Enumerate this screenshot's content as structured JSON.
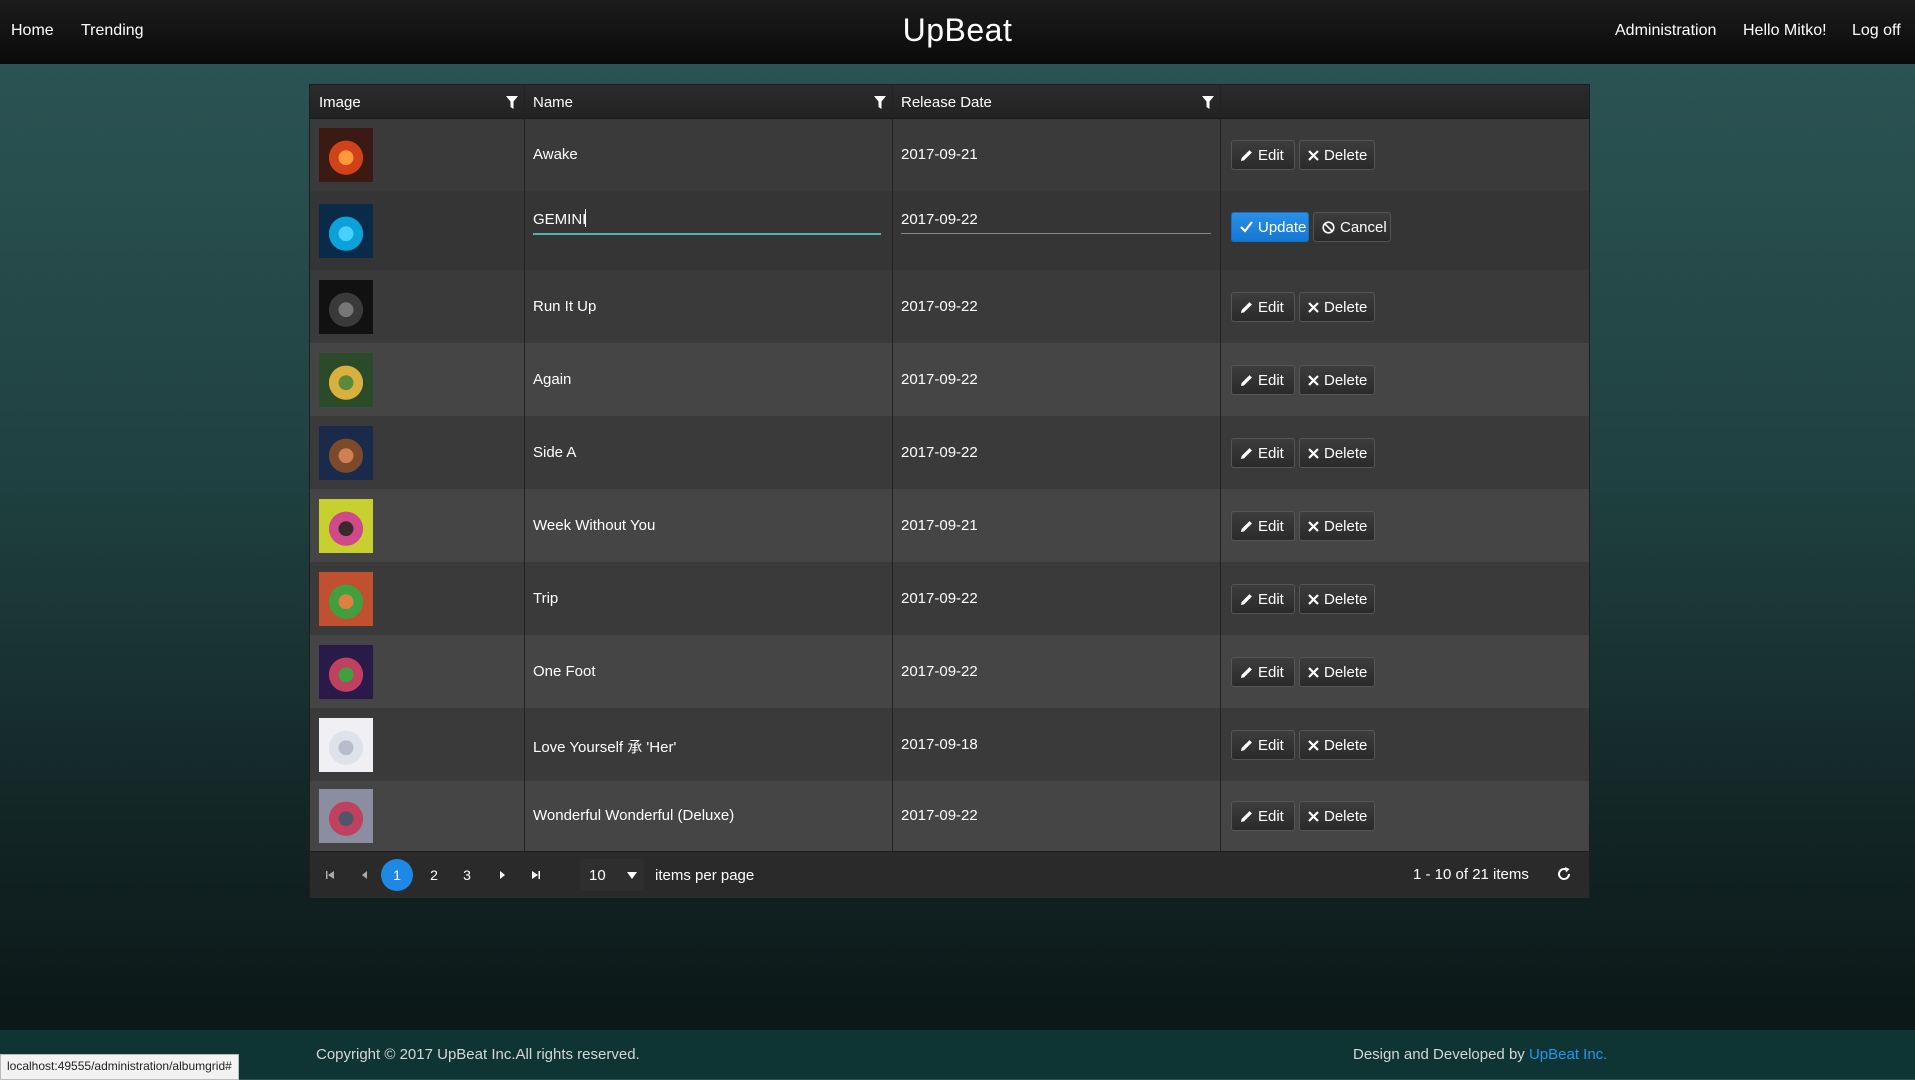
{
  "nav": {
    "home": "Home",
    "trending": "Trending",
    "brand": "UpBeat",
    "administration": "Administration",
    "greeting": "Hello Mitko!",
    "logoff": "Log off"
  },
  "grid": {
    "columns": {
      "image": "Image",
      "name": "Name",
      "release": "Release Date"
    },
    "rows": [
      {
        "name": "Awake",
        "date": "2017-09-21",
        "mode": "view"
      },
      {
        "name": "GEMINI",
        "date": "2017-09-22",
        "mode": "edit"
      },
      {
        "name": "Run It Up",
        "date": "2017-09-22",
        "mode": "view"
      },
      {
        "name": "Again",
        "date": "2017-09-22",
        "mode": "view"
      },
      {
        "name": "Side A",
        "date": "2017-09-22",
        "mode": "view"
      },
      {
        "name": "Week Without You",
        "date": "2017-09-21",
        "mode": "view"
      },
      {
        "name": "Trip",
        "date": "2017-09-22",
        "mode": "view"
      },
      {
        "name": "One Foot",
        "date": "2017-09-22",
        "mode": "view"
      },
      {
        "name": "Love Yourself 承 'Her'",
        "date": "2017-09-18",
        "mode": "view"
      },
      {
        "name": "Wonderful Wonderful (Deluxe)",
        "date": "2017-09-22",
        "mode": "view"
      }
    ],
    "buttons": {
      "edit": "Edit",
      "delete": "Delete",
      "update": "Update",
      "cancel": "Cancel"
    }
  },
  "pager": {
    "pages": [
      "1",
      "2",
      "3"
    ],
    "current_page": "1",
    "page_size": "10",
    "items_per_page": "items per page",
    "summary": "1 - 10 of 21 items"
  },
  "footer": {
    "copyright": "Copyright © 2017 UpBeat Inc.All rights reserved.",
    "designed_by": "Design and Developed by ",
    "company_link": "UpBeat Inc."
  },
  "status_url": "localhost:49555/administration/albumgrid#",
  "colors": {
    "accent": "#1e88e5",
    "link": "#2196f3",
    "input_underline": "#4db6ac"
  }
}
